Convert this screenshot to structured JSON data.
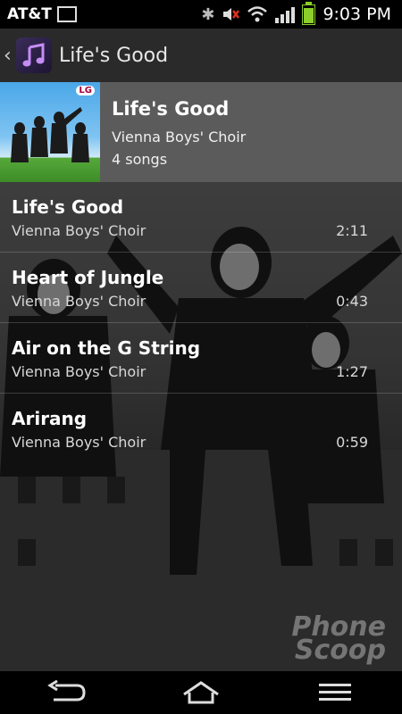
{
  "status_bar": {
    "carrier": "AT&T",
    "time": "9:03 PM"
  },
  "app_bar": {
    "title": "Life's Good"
  },
  "album": {
    "title": "Life's Good",
    "artist": "Vienna Boys' Choir",
    "song_count": "4 songs",
    "art_logo_text": "LG"
  },
  "songs": [
    {
      "title": "Life's Good",
      "artist": "Vienna Boys' Choir",
      "duration": "2:11"
    },
    {
      "title": "Heart of Jungle",
      "artist": "Vienna Boys' Choir",
      "duration": "0:43"
    },
    {
      "title": "Air on the G String",
      "artist": "Vienna Boys' Choir",
      "duration": "1:27"
    },
    {
      "title": "Arirang",
      "artist": "Vienna Boys' Choir",
      "duration": "0:59"
    }
  ],
  "watermark": {
    "line1": "Phone",
    "line2": "Scoop"
  },
  "icons": {
    "status": [
      "image-icon",
      "bluetooth-icon",
      "mute-icon",
      "wifi-icon",
      "signal-icon",
      "battery-icon"
    ],
    "nav": [
      "back-icon",
      "home-icon",
      "menu-icon"
    ]
  },
  "colors": {
    "battery": "#8ccf2a",
    "album_header_bg": "#5b5b5b",
    "app_bar_bg": "#2a2a2a"
  }
}
